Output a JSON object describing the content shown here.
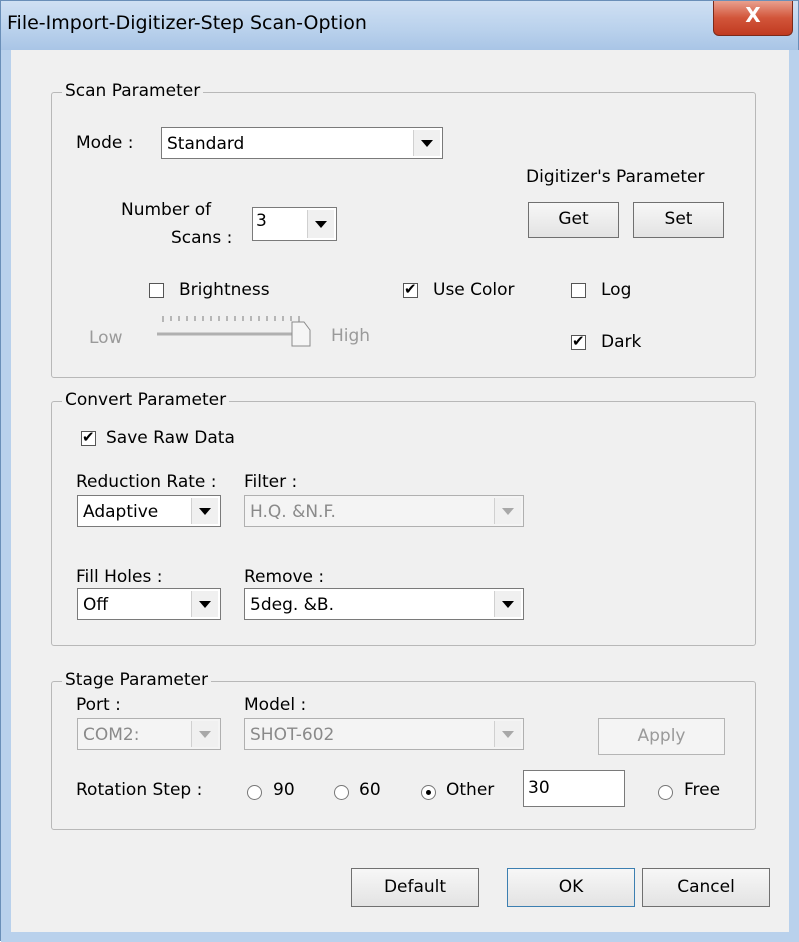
{
  "window": {
    "title": "File-Import-Digitizer-Step Scan-Option",
    "close_glyph": "X"
  },
  "scan": {
    "group_label": "Scan Parameter",
    "mode_label": "Mode :",
    "mode_value": "Standard",
    "num_scans_label_1": "Number of",
    "num_scans_label_2": "Scans :",
    "num_scans_value": "3",
    "digitizer_label": "Digitizer's Parameter",
    "get_label": "Get",
    "set_label": "Set",
    "brightness_label": "Brightness",
    "brightness_checked": false,
    "use_color_label": "Use Color",
    "use_color_checked": true,
    "log_label": "Log",
    "log_checked": false,
    "dark_label": "Dark",
    "dark_checked": true,
    "slider_low": "Low",
    "slider_high": "High",
    "slider_value": 1.0
  },
  "convert": {
    "group_label": "Convert Parameter",
    "save_raw_label": "Save Raw Data",
    "save_raw_checked": true,
    "reduction_label": "Reduction Rate :",
    "reduction_value": "Adaptive",
    "filter_label": "Filter :",
    "filter_value": "H.Q. &N.F.",
    "fill_holes_label": "Fill Holes :",
    "fill_holes_value": "Off",
    "remove_label": "Remove :",
    "remove_value": "5deg. &B."
  },
  "stage": {
    "group_label": "Stage Parameter",
    "port_label": "Port :",
    "port_value": "COM2:",
    "model_label": "Model :",
    "model_value": "SHOT-602",
    "apply_label": "Apply",
    "rotation_label": "Rotation Step :",
    "opt_90": "90",
    "opt_60": "60",
    "opt_other": "Other",
    "other_value": "30",
    "opt_free": "Free",
    "selected": "Other"
  },
  "footer": {
    "default_label": "Default",
    "ok_label": "OK",
    "cancel_label": "Cancel"
  },
  "colors": {
    "titlebar": "#b9d1ec",
    "close": "#c03a20",
    "dialog_bg": "#f0f0f0"
  }
}
